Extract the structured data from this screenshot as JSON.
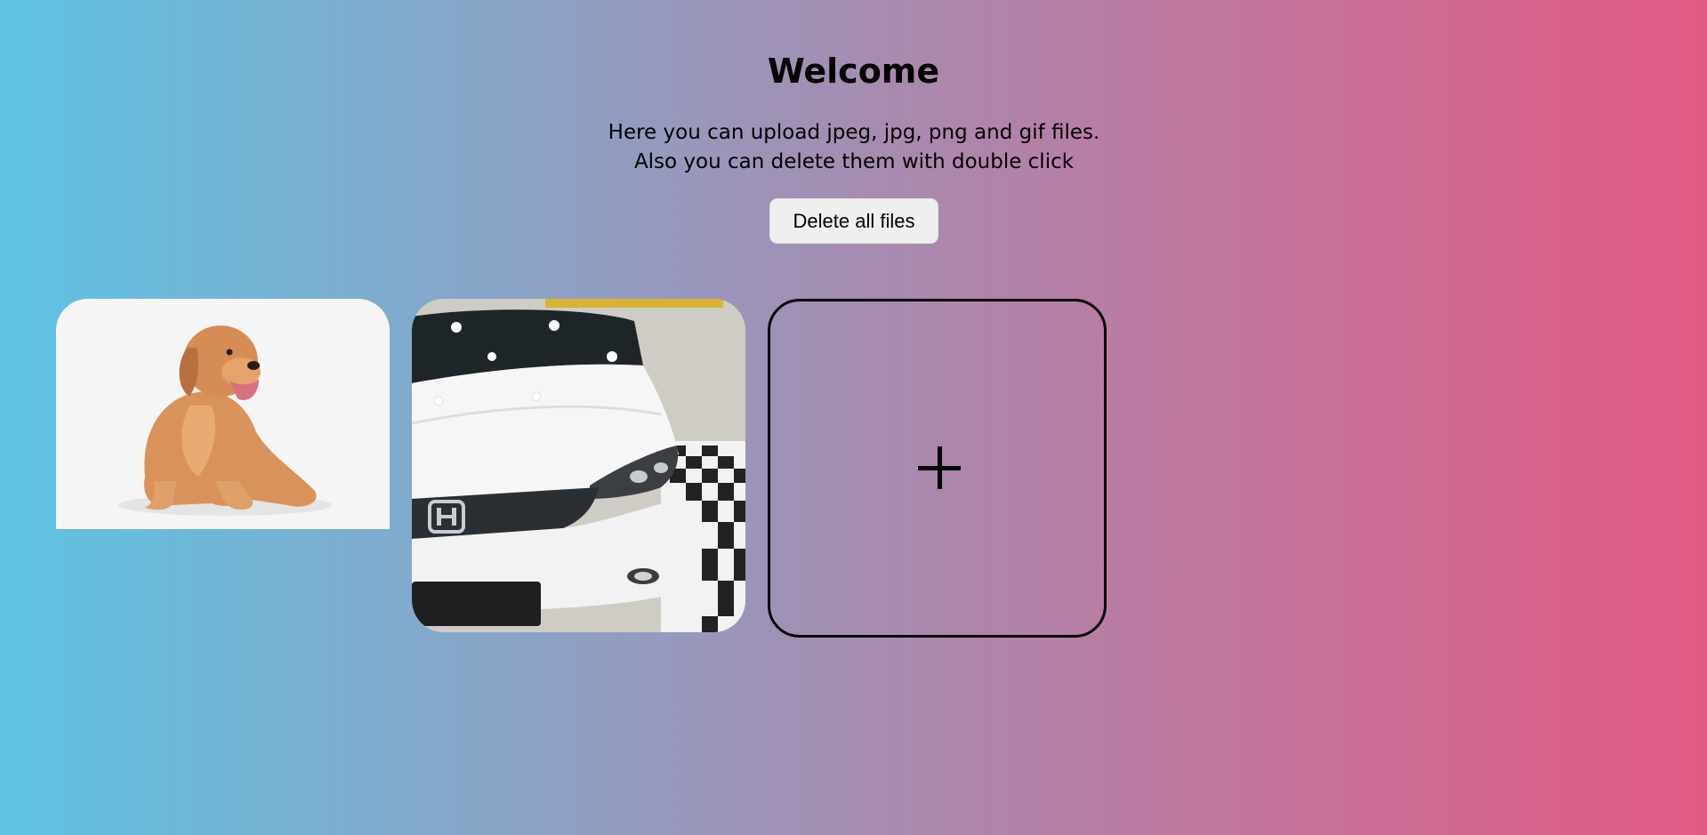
{
  "page": {
    "title": "Welcome",
    "description": "Here you can upload jpeg, jpg, png and gif files. Also you can delete them with double click",
    "delete_all_label": "Delete all files"
  },
  "gallery": {
    "items": [
      {
        "name": "golden-retriever-image",
        "kind": "image"
      },
      {
        "name": "white-honda-car-image",
        "kind": "image"
      }
    ],
    "add_icon": "plus-icon"
  },
  "colors": {
    "gradient_left": "#5ec3e3",
    "gradient_right": "#e25a84",
    "button_bg": "#efefef"
  }
}
